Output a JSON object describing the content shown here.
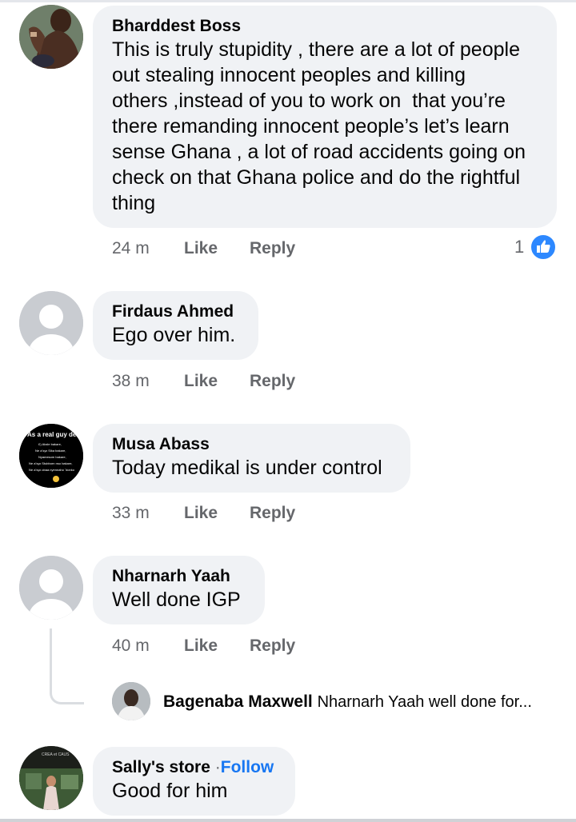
{
  "comments": [
    {
      "author": "Bharddest Boss",
      "text": "This is truly stupidity , there are a lot of people\nout stealing innocent peoples and killing\nothers ,instead of you to work on  that you’re\nthere remanding innocent people’s let’s learn\nsense Ghana , a lot of road accidents going on\ncheck on that Ghana police and do the rightful\nthing",
      "time": "24 m",
      "like": "Like",
      "reply": "Reply",
      "reactions": "1",
      "reaction_icon": "thumbs-up-icon"
    },
    {
      "author": "Firdaus Ahmed",
      "text": "Ego over him.",
      "time": "38 m",
      "like": "Like",
      "reply": "Reply"
    },
    {
      "author": "Musa Abass",
      "text": "Today medikal is under control",
      "time": "33 m",
      "like": "Like",
      "reply": "Reply",
      "avatar_text": [
        "As a real guy de",
        "Ɛ) Abɛle bakare,",
        "Ne aʼsyɛ Sika bakare,",
        "Nyamesom bakare,",
        "Ne aʼsyɛ Stubborn nso bakare,",
        "Ne aʼsyɛ obaa nyennaho ̃ donko"
      ]
    },
    {
      "author": "Nharnarh Yaah",
      "text": "Well done IGP",
      "time": "40 m",
      "like": "Like",
      "reply": "Reply"
    },
    {
      "author": "Sally's store",
      "follow_sep": "·",
      "follow": "Follow",
      "text": "Good for him",
      "avatar_text": "CREA et CAUS"
    }
  ],
  "reply_preview": {
    "author": "Bagenaba Maxwell",
    "text": "Nharnarh Yaah  well done for..."
  },
  "colors": {
    "accent": "#1877f2",
    "bubble": "#f0f2f5",
    "meta": "#65676b",
    "reaction": "#2d88ff"
  }
}
